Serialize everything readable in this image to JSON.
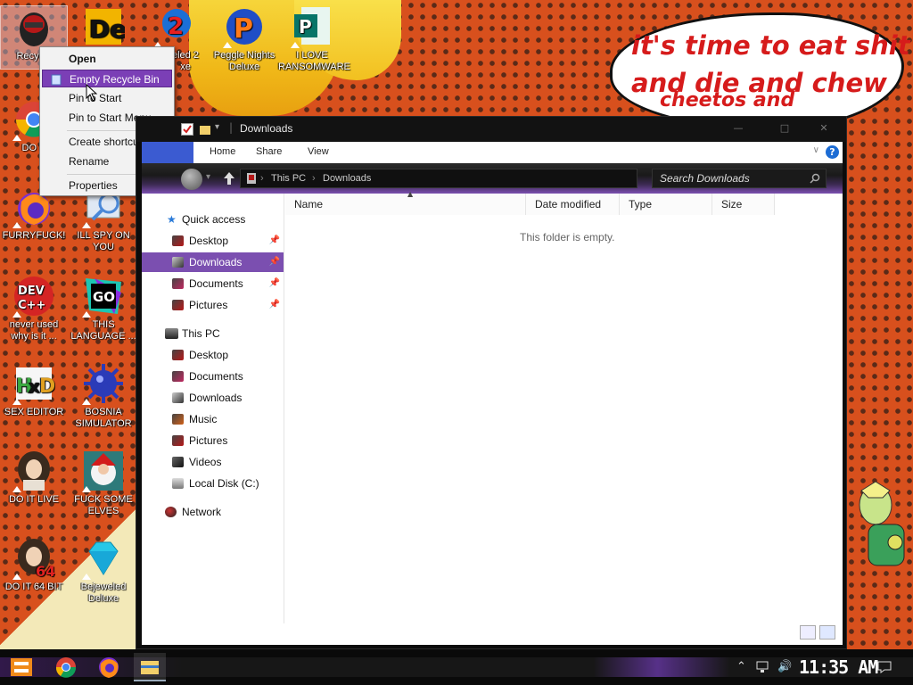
{
  "wallpaper": {
    "speech_bubble_lines": [
      "it's time to eat shit",
      "and die and chew",
      "cheetos and"
    ]
  },
  "desktop_icons": [
    {
      "label": "Recycle",
      "icon": "recycle-bin-icon"
    },
    {
      "label": "",
      "icon": "de-app-icon"
    },
    {
      "label": "eled 2\nxe",
      "icon": "peggle-2-icon"
    },
    {
      "label": "Peggle Nights\nDeluxe",
      "icon": "peggle-nights-icon"
    },
    {
      "label": "I LOVE\nRANSOMWARE",
      "icon": "publisher-icon"
    },
    {
      "label": "DO E",
      "icon": "chrome-icon"
    },
    {
      "label": "FURRYFUCK!",
      "icon": "firefox-icon"
    },
    {
      "label": "ILL SPY ON\nYOU",
      "icon": "spy-icon"
    },
    {
      "label": "never used\nwhy is it ...",
      "icon": "dev-cpp-icon"
    },
    {
      "label": "THIS\nLANGUAGE ...",
      "icon": "goland-icon"
    },
    {
      "label": "SEX EDITOR",
      "icon": "hxd-icon"
    },
    {
      "label": "BOSNIA\nSIMULATOR",
      "icon": "mine-ball-icon"
    },
    {
      "label": "DO IT LIVE",
      "icon": "portrait-icon"
    },
    {
      "label": "FUCK SOME\nELVES",
      "icon": "santa-icon"
    },
    {
      "label": "DO IT 64 BIT",
      "icon": "portrait-64-icon"
    },
    {
      "label": "Bejeweled\nDeluxe",
      "icon": "diamond-icon"
    }
  ],
  "context_menu": {
    "items": [
      "Open",
      "Empty Recycle Bin",
      "Pin to Start",
      "Pin to Start Menu",
      "Create shortcut",
      "Rename",
      "Properties"
    ]
  },
  "explorer": {
    "title": "Downloads",
    "ribbon_tabs": [
      "Home",
      "Share",
      "View"
    ],
    "breadcrumb": [
      "This PC",
      "Downloads"
    ],
    "search_placeholder": "Search Downloads",
    "nav": {
      "quick_access": "Quick access",
      "quick_items": [
        "Desktop",
        "Downloads",
        "Documents",
        "Pictures"
      ],
      "this_pc": "This PC",
      "pc_items": [
        "Desktop",
        "Documents",
        "Downloads",
        "Music",
        "Pictures",
        "Videos",
        "Local Disk (C:)"
      ],
      "network": "Network"
    },
    "columns": [
      "Name",
      "Date modified",
      "Type",
      "Size"
    ],
    "empty_message": "This folder is empty."
  },
  "taskbar": {
    "clock": "11:35 AM",
    "pinned": [
      "start-icon",
      "chrome-icon",
      "firefox-icon",
      "file-explorer-icon"
    ]
  }
}
